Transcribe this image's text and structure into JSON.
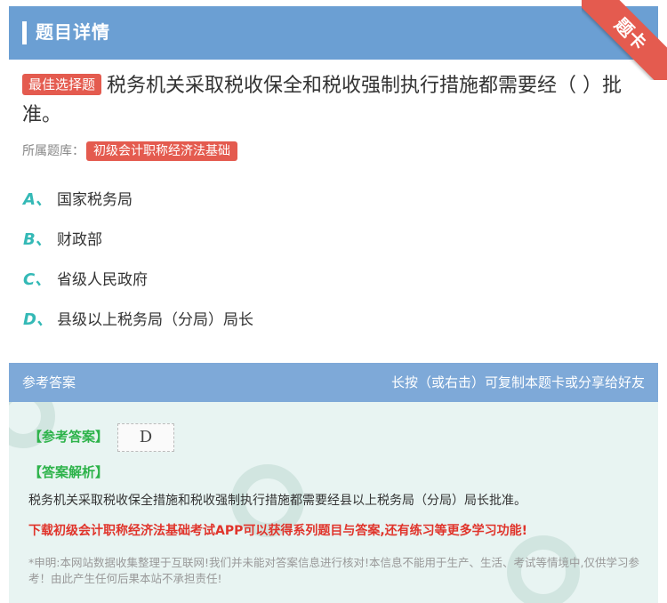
{
  "header": {
    "title": "题目详情"
  },
  "ribbon": {
    "label": "题卡"
  },
  "question": {
    "tag": "最佳选择题",
    "text": "税务机关采取税收保全和税收强制执行措施都需要经（  ）批准。",
    "bank_label": "所属题库：",
    "bank_name": "初级会计职称经济法基础"
  },
  "options": [
    {
      "letter": "A、",
      "text": "国家税务局"
    },
    {
      "letter": "B、",
      "text": "财政部"
    },
    {
      "letter": "C、",
      "text": "省级人民政府"
    },
    {
      "letter": "D、",
      "text": "县级以上税务局（分局）局长"
    }
  ],
  "answer": {
    "header_left": "参考答案",
    "header_right": "长按（或右击）可复制本题卡或分享给好友",
    "ref_label": "【参考答案】",
    "ref_value": "D",
    "analysis_label": "【答案解析】",
    "analysis_text": "税务机关采取税收保全措施和税收强制执行措施都需要经县以上税务局（分局）局长批准。",
    "promo": "下载初级会计职称经济法基础考试APP可以获得系列题目与答案,还有练习等更多学习功能!",
    "disclaimer": "*申明:本网站数据收集整理于互联网!我们并未能对答案信息进行核对!本信息不能用于生产、生活、考试等情境中,仅供学习参考！由此产生任何后果本站不承担责任!"
  },
  "colors": {
    "header_bg": "#6b9fd3",
    "accent_red": "#e45b4f",
    "option_letter": "#34b9b6",
    "answer_green": "#2db34a"
  }
}
